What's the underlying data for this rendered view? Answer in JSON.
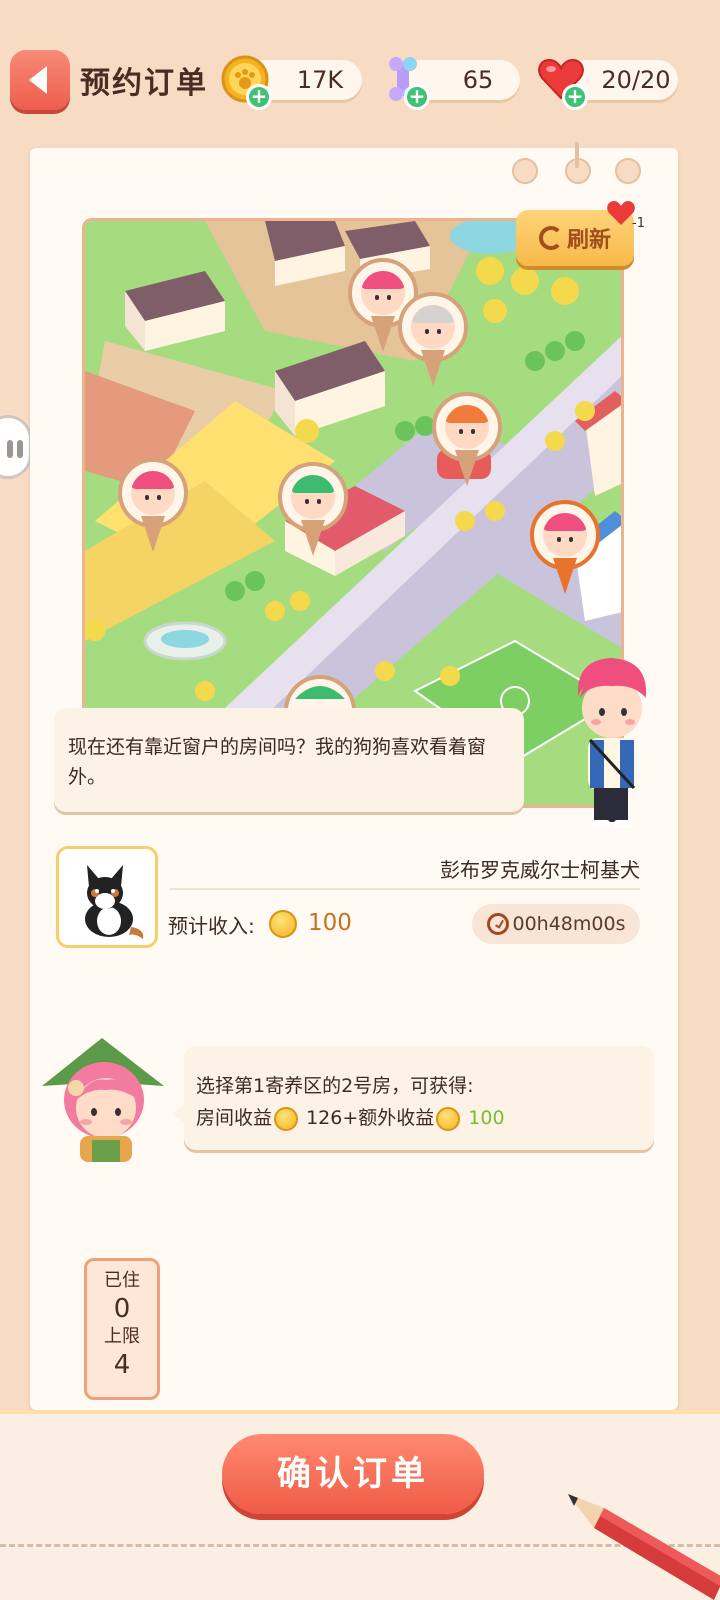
{
  "header": {
    "title": "预约订单",
    "coins": "17K",
    "bones": "65",
    "hearts": "20/20"
  },
  "map": {
    "refresh_label": "刷新",
    "refresh_cost": "-1"
  },
  "customer": {
    "message": "现在还有靠近窗户的房间吗？我的狗狗喜欢看着窗外。"
  },
  "pet": {
    "breed": "彭布罗克威尔士柯基犬",
    "income_label": "预计收入:",
    "income_value": "100",
    "timer": "00h48m00s"
  },
  "guide": {
    "line1": "选择第1寄养区的2号房，可获得:",
    "room_income_label": "房间收益",
    "room_income_value": "126+额外收益",
    "extra_value": "100"
  },
  "capacity": {
    "occupied_label": "已住",
    "occupied_value": "0",
    "limit_label": "上限",
    "limit_value": "4"
  },
  "actions": {
    "confirm": "确认订单"
  },
  "colors": {
    "accent": "#ef5b47",
    "background": "#f7dcc3",
    "paper": "#fffaf3",
    "green": "#7cbb2f",
    "coin": "#f5b321"
  }
}
